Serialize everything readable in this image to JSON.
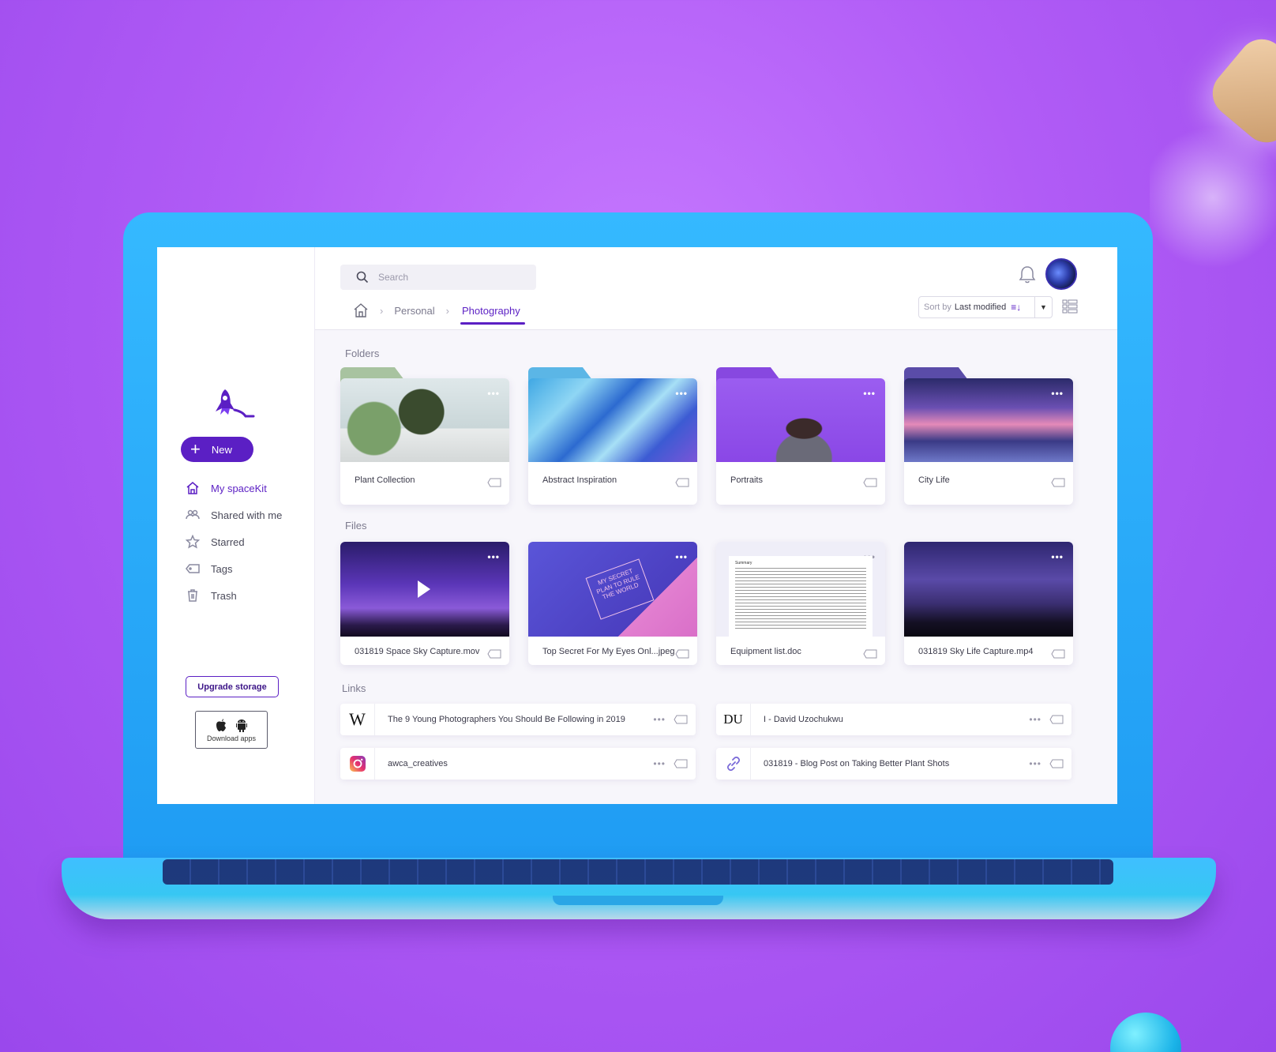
{
  "app": {
    "name": "spaceKit"
  },
  "sidebar": {
    "new_label": "New",
    "items": [
      {
        "label": "My spaceKit",
        "icon": "home-icon",
        "active": true
      },
      {
        "label": "Shared with me",
        "icon": "shared-icon"
      },
      {
        "label": "Starred",
        "icon": "star-icon"
      },
      {
        "label": "Tags",
        "icon": "tag-icon"
      },
      {
        "label": "Trash",
        "icon": "trash-icon"
      }
    ],
    "upgrade_label": "Upgrade storage",
    "download_label": "Download apps"
  },
  "header": {
    "search_placeholder": "Search",
    "breadcrumb": {
      "home_icon": "home-icon",
      "items": [
        "Personal",
        "Photography"
      ]
    },
    "sort": {
      "label": "Sort by",
      "value": "Last modified"
    }
  },
  "sections": {
    "folders": "Folders",
    "files": "Files",
    "links": "Links"
  },
  "folders": [
    {
      "name": "Plant Collection"
    },
    {
      "name": "Abstract Inspiration"
    },
    {
      "name": "Portraits"
    },
    {
      "name": "City Life"
    }
  ],
  "files": [
    {
      "name": "031819 Space Sky Capture.mov"
    },
    {
      "name": "Top Secret For My Eyes Onl...jpeg",
      "thumb_text": "MY SECRET PLAN TO RULE THE WORLD"
    },
    {
      "name": "Equipment list.doc",
      "doc_heading": "Summary"
    },
    {
      "name": "031819 Sky Life Capture.mp4"
    }
  ],
  "links": [
    {
      "title": "The 9 Young Photographers You Should Be Following in 2019",
      "logo": "W"
    },
    {
      "title": "I - David Uzochukwu",
      "logo": "DU"
    },
    {
      "title": "awca_creatives",
      "logo": "instagram-icon"
    },
    {
      "title": "031819 - Blog Post on Taking Better Plant Shots",
      "logo": "link-icon"
    }
  ],
  "colors": {
    "accent": "#5b1fc4",
    "laptop": "#1f9cf3",
    "background": "#b15cf6"
  },
  "more_label": "•••"
}
